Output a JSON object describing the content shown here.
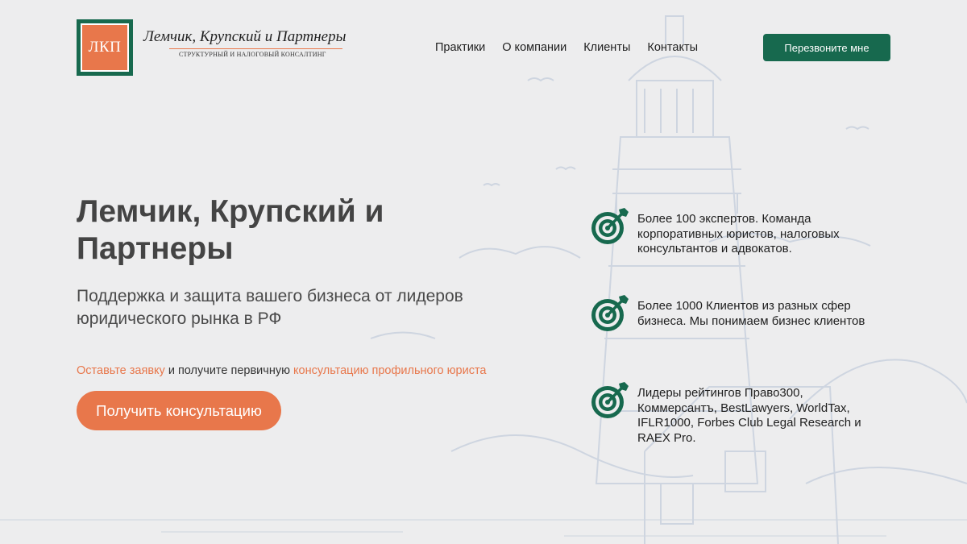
{
  "brand": {
    "logo_mark": "ЛКП",
    "name": "Лемчик, Крупский и Партнеры",
    "tagline": "СТРУКТУРНЫЙ И НАЛОГОВЫЙ КОНСАЛТИНГ"
  },
  "nav": {
    "items": [
      {
        "label": "Практики"
      },
      {
        "label": "О компании"
      },
      {
        "label": "Клиенты"
      },
      {
        "label": "Контакты"
      }
    ]
  },
  "header": {
    "callback_label": "Перезвоните мне"
  },
  "hero": {
    "title": "Лемчик, Крупский и Партнеры",
    "subtitle": "Поддержка и защита вашего бизнеса от лидеров юридического рынка в РФ",
    "cta_link_1": "Оставьте заявку",
    "cta_middle": " и получите первичную ",
    "cta_link_2": "консультацию профильного юриста",
    "button_label": "Получить консультацию"
  },
  "features": [
    {
      "icon": "target-icon",
      "text": "Более 100 экспертов. Команда корпоративных юристов, налоговых консультантов и адвокатов."
    },
    {
      "icon": "target-icon",
      "text": "Более 1000 Клиентов из разных сфер бизнеса. Мы понимаем бизнес клиентов"
    },
    {
      "icon": "target-icon",
      "text": "Лидеры рейтингов Право300, Коммерсантъ, BestLawyers, WorldTax, IFLR1000, Forbes Club Legal Research и RAEX Pro."
    }
  ],
  "colors": {
    "brand_green": "#17694e",
    "accent_orange": "#e8774b",
    "background": "#ededee",
    "sketch_blue": "#a9b8cf"
  }
}
